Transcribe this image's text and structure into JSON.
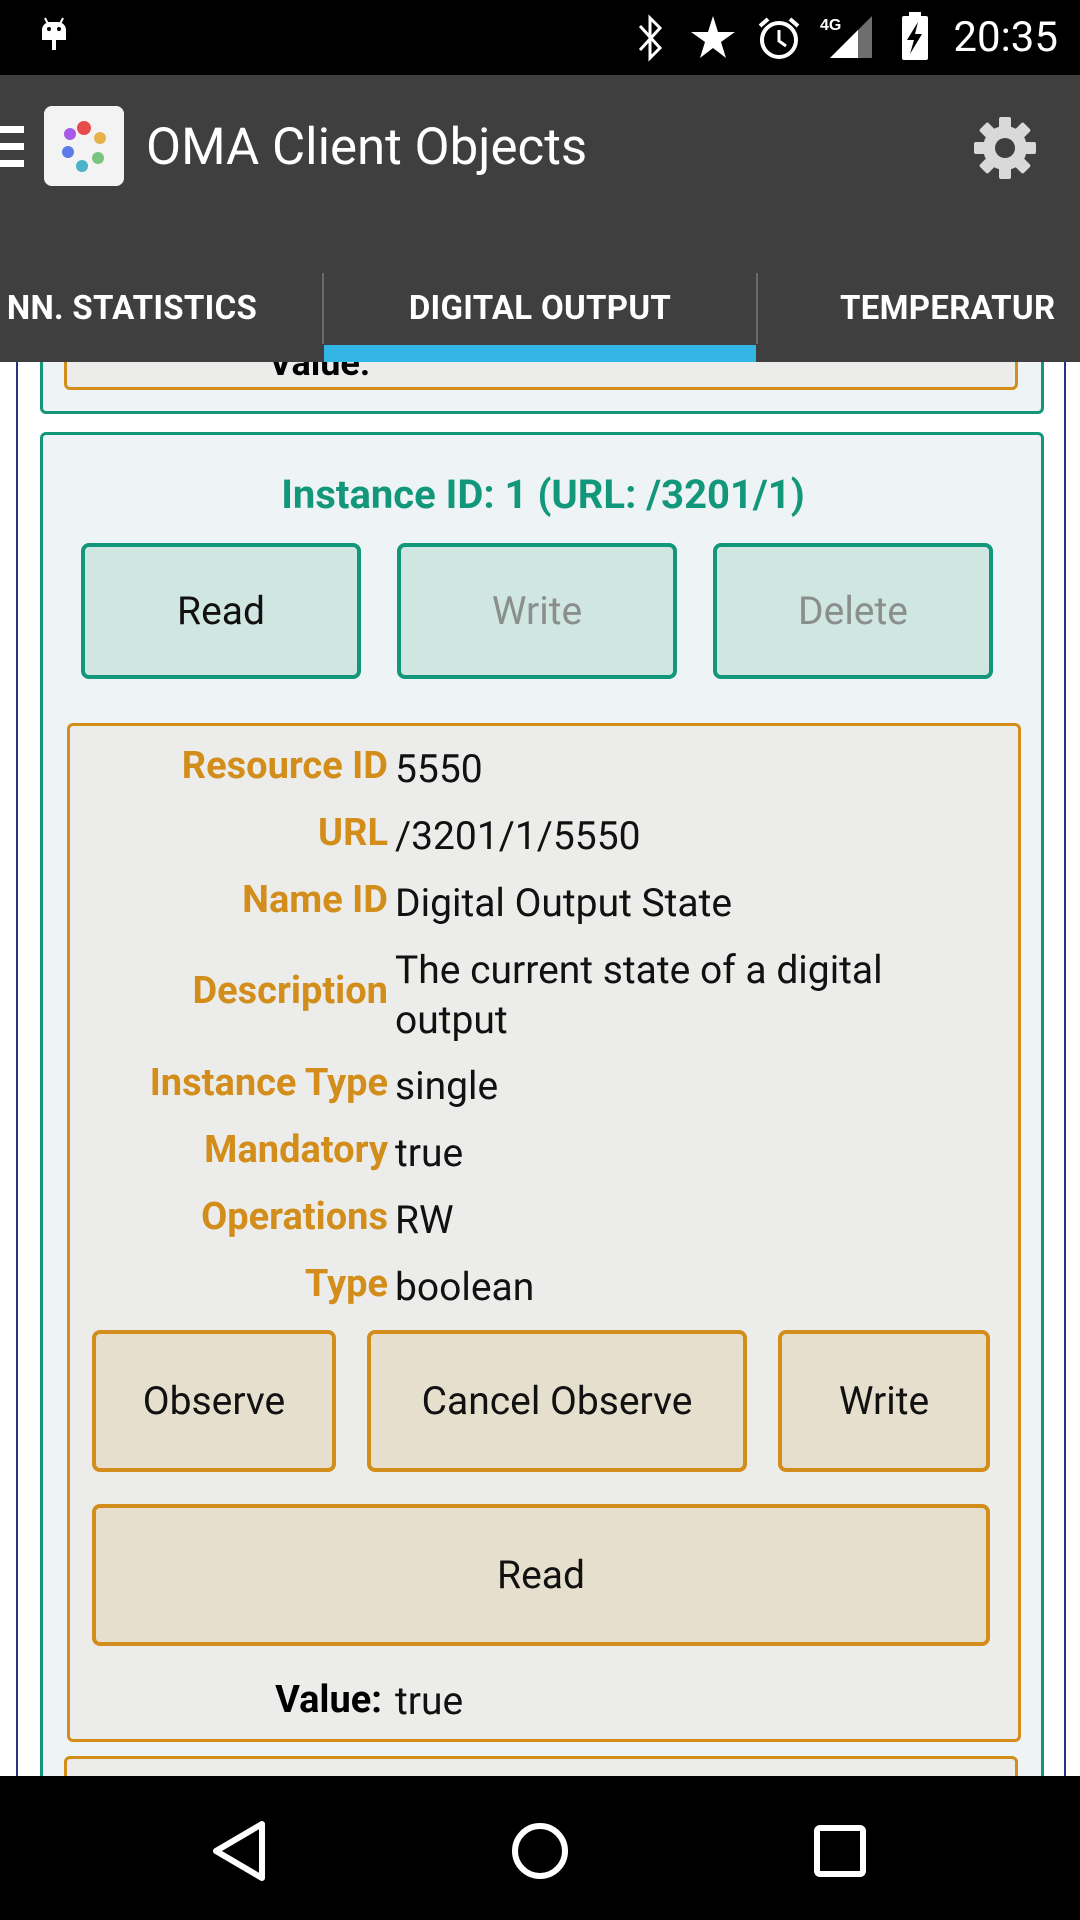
{
  "status_bar": {
    "time": "20:35",
    "network": "4G"
  },
  "app_bar": {
    "title": "OMA Client Objects"
  },
  "tabs": [
    {
      "label": "NN. STATISTICS"
    },
    {
      "label": "DIGITAL OUTPUT"
    },
    {
      "label": "TEMPERATUR"
    }
  ],
  "prev_section": {
    "value_label": "Value:"
  },
  "instance": {
    "title": "Instance ID: 1 (URL: /3201/1)",
    "buttons": {
      "read": "Read",
      "write": "Write",
      "delete": "Delete"
    }
  },
  "resource": {
    "rows": [
      {
        "label": "Resource ID",
        "value": "5550"
      },
      {
        "label": "URL",
        "value": "/3201/1/5550"
      },
      {
        "label": "Name ID",
        "value": "Digital Output State"
      },
      {
        "label": "Description",
        "value": "The current state of a digital output"
      },
      {
        "label": "Instance Type",
        "value": "single"
      },
      {
        "label": "Mandatory",
        "value": "true"
      },
      {
        "label": "Operations",
        "value": "RW"
      },
      {
        "label": "Type",
        "value": "boolean"
      }
    ],
    "buttons": {
      "observe": "Observe",
      "cancel_observe": "Cancel Observe",
      "write": "Write",
      "read": "Read"
    },
    "value_label": "Value:",
    "value": "true"
  },
  "colors": {
    "accent_teal": "#13977b",
    "accent_orange": "#d28d1b",
    "tab_indicator": "#33b5e5"
  }
}
